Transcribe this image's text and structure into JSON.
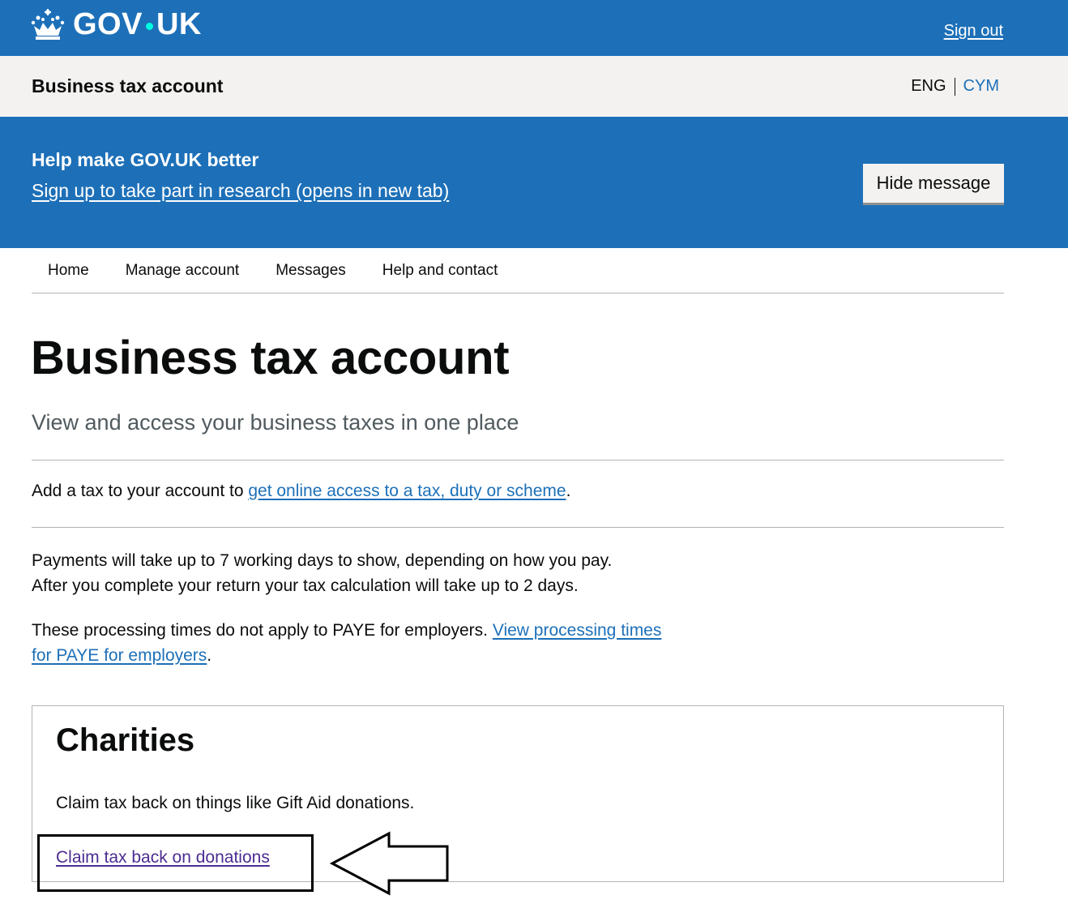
{
  "header": {
    "logo_text_left": "GOV",
    "logo_text_right": "UK",
    "sign_out": "Sign out"
  },
  "service": {
    "name": "Business tax account",
    "lang_eng": "ENG",
    "lang_cym": "CYM"
  },
  "banner": {
    "title": "Help make GOV.UK better",
    "link": "Sign up to take part in research (opens in new tab)",
    "hide_button": "Hide message"
  },
  "nav": {
    "items": [
      "Home",
      "Manage account",
      "Messages",
      "Help and contact"
    ]
  },
  "main": {
    "title": "Business tax account",
    "lede": "View and access your business taxes in one place",
    "add_tax_prefix": "Add a tax to your account to ",
    "add_tax_link": "get online access to a tax, duty or scheme",
    "add_tax_suffix": ".",
    "payments_line1": "Payments will take up to 7 working days to show, depending on how you pay.",
    "payments_line2": "After you complete your return your tax calculation will take up to 2 days.",
    "processing_prefix": "These processing times do not apply to PAYE for employers. ",
    "processing_link": "View processing times for PAYE for employers",
    "processing_suffix": "."
  },
  "charities": {
    "title": "Charities",
    "description": "Claim tax back on things like Gift Aid donations.",
    "link": "Claim tax back on donations"
  },
  "colors": {
    "brand_blue": "#1d70b8",
    "link_visited": "#4c2c92",
    "service_bar": "#f3f2f1"
  }
}
